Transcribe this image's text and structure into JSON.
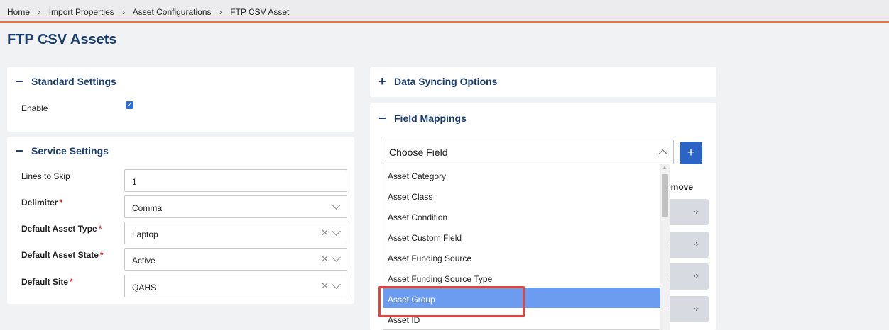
{
  "breadcrumb": [
    "Home",
    "Import Properties",
    "Asset Configurations",
    "FTP CSV Asset"
  ],
  "page": {
    "title": "FTP CSV Assets"
  },
  "standard_settings": {
    "title": "Standard Settings",
    "toggle": "−",
    "enable_label": "Enable",
    "enable_checked": true
  },
  "service_settings": {
    "title": "Service Settings",
    "toggle": "−",
    "lines_to_skip": {
      "label": "Lines to Skip",
      "value": "1"
    },
    "delimiter": {
      "label": "Delimiter",
      "value": "Comma"
    },
    "default_asset_type": {
      "label": "Default Asset Type",
      "value": "Laptop"
    },
    "default_asset_state": {
      "label": "Default Asset State",
      "value": "Active"
    },
    "default_site": {
      "label": "Default Site",
      "value": "QAHS"
    },
    "required_mark": "*"
  },
  "data_syncing": {
    "title": "Data Syncing Options",
    "toggle": "+"
  },
  "field_mappings": {
    "title": "Field Mappings",
    "toggle": "−",
    "choose_field": "Choose Field",
    "add_label": "+",
    "remove_header": "emove",
    "options": [
      "Asset Category",
      "Asset Class",
      "Asset Condition",
      "Asset Custom Field",
      "Asset Funding Source",
      "Asset Funding Source Type",
      "Asset Group",
      "Asset ID"
    ],
    "selected_option": "Asset Group",
    "row_colon": ":",
    "row_grid_icon": "⁘"
  },
  "colors": {
    "accent": "#2b63c6",
    "title": "#1b3d6e",
    "selected": "#6b9cf0",
    "highlight": "#e0443b",
    "rule": "#e8743b"
  }
}
